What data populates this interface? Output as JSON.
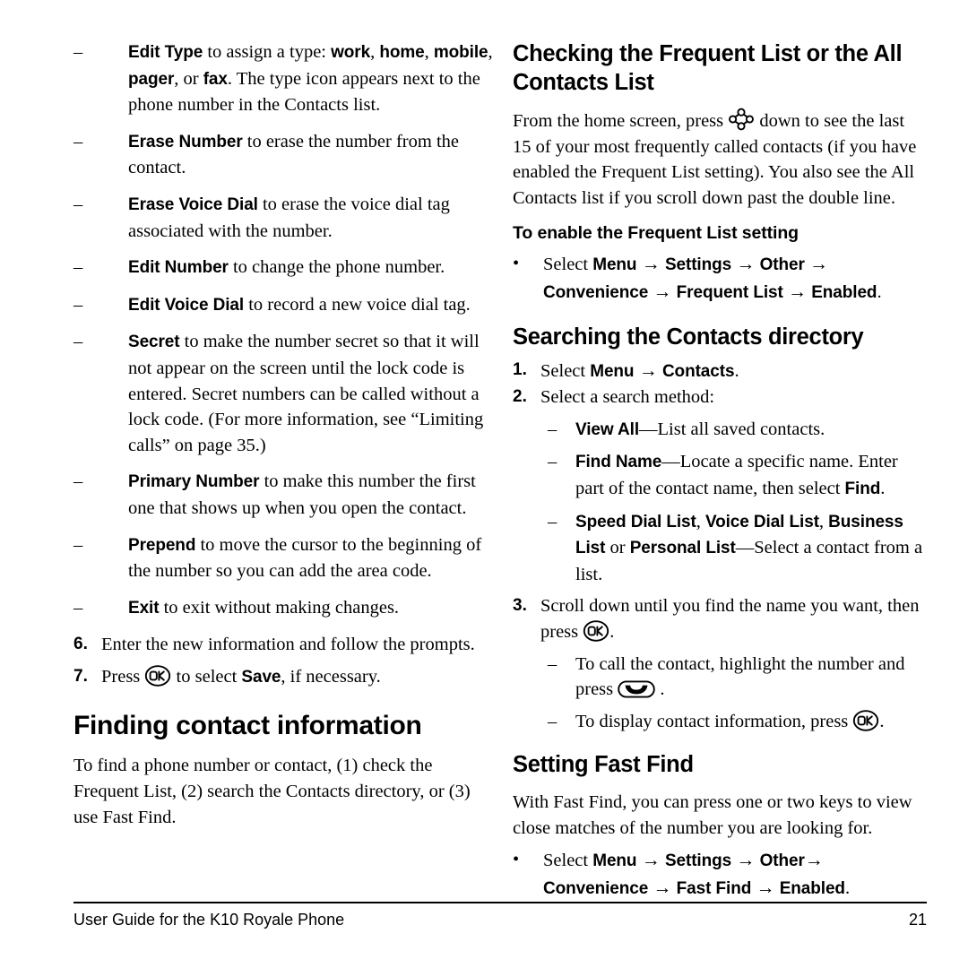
{
  "document": {
    "title": "User Guide for the K10 Royale Phone",
    "page_number": "21"
  },
  "icons": {
    "ok_key": "ok-key-icon",
    "nav_key": "navigation-key-icon",
    "send_key": "send-key-icon"
  },
  "left_column": {
    "option_list": [
      {
        "marker": "–",
        "term": "Edit Type",
        "rest": " to assign a type: ",
        "inline": [
          {
            "bold": "work"
          },
          {
            "text": ", "
          },
          {
            "bold": "home"
          },
          {
            "text": ", "
          },
          {
            "bold": "mobile"
          },
          {
            "text": ", "
          },
          {
            "bold": "pager"
          },
          {
            "text": ", or "
          },
          {
            "bold": "fax"
          },
          {
            "text": ". The type icon appears next to the phone number in the Contacts list."
          }
        ]
      },
      {
        "marker": "–",
        "term": "Erase Number",
        "rest": " to erase the number from the contact."
      },
      {
        "marker": "–",
        "term": "Erase Voice Dial",
        "rest": " to erase the voice dial tag associated with the number."
      },
      {
        "marker": "–",
        "term": "Edit Number",
        "rest": " to change the phone number."
      },
      {
        "marker": "–",
        "term": "Edit Voice Dial",
        "rest": " to record a new voice dial tag."
      },
      {
        "marker": "–",
        "term": "Secret",
        "rest": " to make the number secret so that it will not appear on the screen until the lock code is entered. Secret numbers can be called without a lock code. (For more information, see “Limiting calls” on page 35.)"
      },
      {
        "marker": "–",
        "term": "Primary Number",
        "rest": " to make this number the first one that shows up when you open the contact."
      },
      {
        "marker": "–",
        "term": "Prepend",
        "rest": " to move the cursor to the beginning of the number so you can add the area code."
      },
      {
        "marker": "–",
        "term": "Exit",
        "rest": " to exit without making changes."
      }
    ],
    "step_6": {
      "marker": "6.",
      "text": "Enter the new information and follow the prompts."
    },
    "step_7": {
      "marker": "7.",
      "before_icon": "Press ",
      "after_icon": " to select ",
      "bold_term": "Save",
      "tail": ", if necessary."
    },
    "heading_finding": "Finding contact information",
    "finding_body": "To find a phone number or contact, (1) check the Frequent List, (2) search the Contacts directory, or (3) use Fast Find."
  },
  "right_column": {
    "heading_checking": "Checking the Frequent List or the All Contacts List",
    "checking_body_before_icon": "From the home screen, press ",
    "checking_body_after_icon": " down to see the last 15 of your most frequently called contacts (if you have enabled the Frequent List setting). You also see the All Contacts list if you scroll down past the double line.",
    "heading_enable_frequent": "To enable the Frequent List setting",
    "enable_frequent_bullet": {
      "marker": "•",
      "lead": "Select ",
      "path": [
        "Menu",
        "Settings",
        "Other",
        "Convenience",
        "Frequent List",
        "Enabled"
      ],
      "arrow": "→",
      "tail": "."
    },
    "heading_searching": "Searching the Contacts directory",
    "search_step_1": {
      "marker": "1.",
      "lead": "Select ",
      "path": [
        "Menu",
        "Contacts"
      ],
      "arrow": "→",
      "tail": "."
    },
    "search_step_2": {
      "marker": "2.",
      "text": "Select a search method:",
      "methods": [
        {
          "marker": "–",
          "term": "View All",
          "dash": "—",
          "rest": "List all saved contacts."
        },
        {
          "marker": "–",
          "term": "Find Name",
          "dash": "—",
          "rest": "Locate a specific name. Enter part of the contact name, then select ",
          "bold_tail": "Find",
          "tail": "."
        },
        {
          "marker": "–",
          "term_parts": [
            "Speed Dial List",
            "Voice Dial List",
            "Business List"
          ],
          "or_text": " or ",
          "term_last": "Personal List",
          "dash": "—",
          "rest": "Select a contact from a list."
        }
      ]
    },
    "search_step_3": {
      "marker": "3.",
      "before_icon": "Scroll down until you find the name you want, then press ",
      "after_icon": ".",
      "sub_items": [
        {
          "marker": "–",
          "before_icon": "To call the contact, highlight the number and press ",
          "after_icon": " ."
        },
        {
          "marker": "–",
          "before_icon": "To display contact information, press ",
          "after_icon": "."
        }
      ]
    },
    "heading_fast_find": "Setting Fast Find",
    "fast_find_body": "With Fast Find, you can press one or two keys to view close matches of the number you are looking for.",
    "fast_find_bullet": {
      "marker": "•",
      "lead": "Select ",
      "path": [
        "Menu",
        "Settings",
        "Other",
        "Convenience",
        "Fast Find",
        "Enabled"
      ],
      "arrow": "→",
      "tail": "."
    }
  }
}
